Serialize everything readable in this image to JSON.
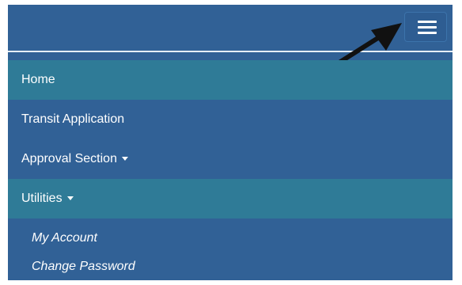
{
  "navbar": {
    "toggle_icon": "hamburger-menu-icon",
    "arrow_annotation_icon": "pointer-arrow-icon"
  },
  "menu": {
    "items": [
      {
        "label": "Home",
        "active": true
      },
      {
        "label": "Transit Application",
        "active": false
      },
      {
        "label": "Approval Section",
        "active": false,
        "dropdown": true
      },
      {
        "label": "Utilities",
        "active": true,
        "dropdown": true
      }
    ],
    "utilities_submenu": [
      {
        "label": "My Account"
      },
      {
        "label": "Change Password"
      }
    ]
  },
  "colors": {
    "navbar_bg": "#316196",
    "active_item_bg": "#2f7b97",
    "text": "#ffffff",
    "divider": "#e6eef6",
    "arrow": "#111111"
  }
}
